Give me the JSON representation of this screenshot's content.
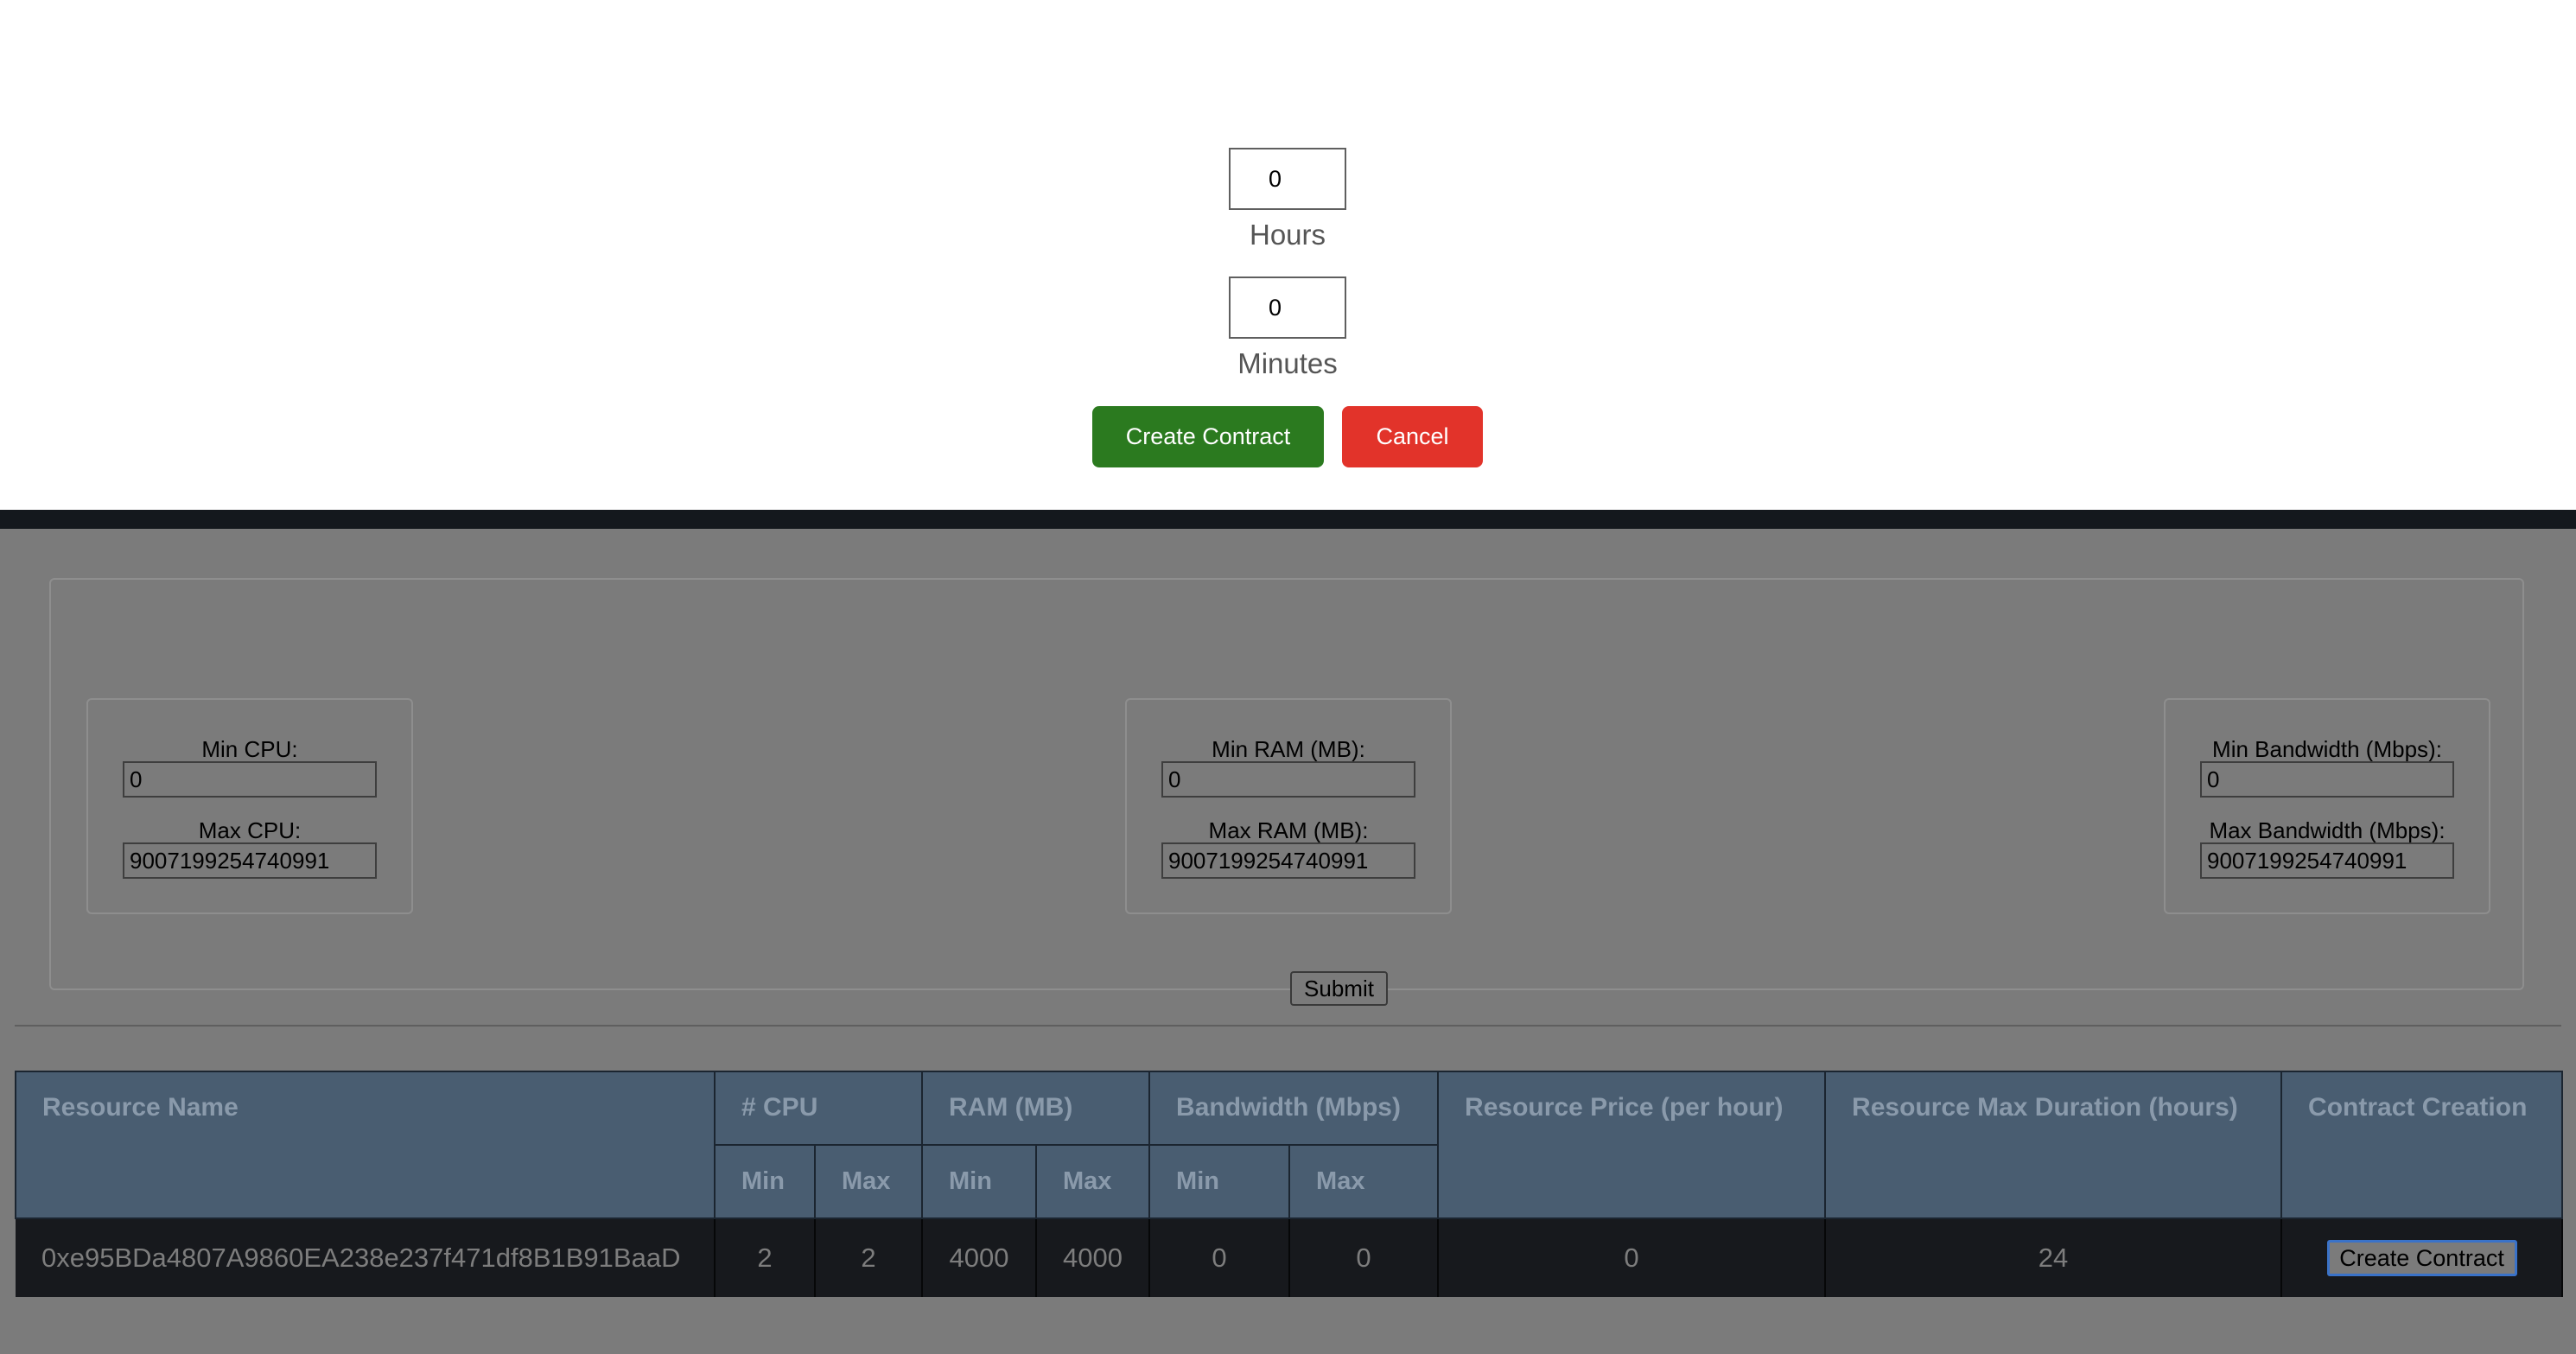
{
  "modal": {
    "hours_value": "0",
    "hours_label": "Hours",
    "minutes_value": "0",
    "minutes_label": "Minutes",
    "create_label": "Create Contract",
    "cancel_label": "Cancel",
    "create_color": "#2b7a1f",
    "cancel_color": "#e2332a"
  },
  "filters": {
    "cpu": {
      "min_label": "Min CPU:",
      "min_value": "0",
      "max_label": "Max CPU:",
      "max_value": "9007199254740991"
    },
    "ram": {
      "min_label": "Min RAM (MB):",
      "min_value": "0",
      "max_label": "Max RAM (MB):",
      "max_value": "9007199254740991"
    },
    "bandwidth": {
      "min_label": "Min Bandwidth (Mbps):",
      "min_value": "0",
      "max_label": "Max Bandwidth (Mbps):",
      "max_value": "9007199254740991"
    },
    "submit_label": "Submit"
  },
  "table": {
    "headers": {
      "resource_name": "Resource Name",
      "cpu": "# CPU",
      "ram": "RAM (MB)",
      "bandwidth": "Bandwidth (Mbps)",
      "price": "Resource Price (per hour)",
      "duration": "Resource Max Duration (hours)",
      "contract": "Contract Creation",
      "min": "Min",
      "max": "Max"
    },
    "rows": [
      {
        "resource_name": "0xe95BDa4807A9860EA238e237f471df8B1B91BaaD",
        "cpu_min": "2",
        "cpu_max": "2",
        "ram_min": "4000",
        "ram_max": "4000",
        "bw_min": "0",
        "bw_max": "0",
        "price": "0",
        "duration": "24",
        "action_label": "Create Contract"
      }
    ]
  }
}
